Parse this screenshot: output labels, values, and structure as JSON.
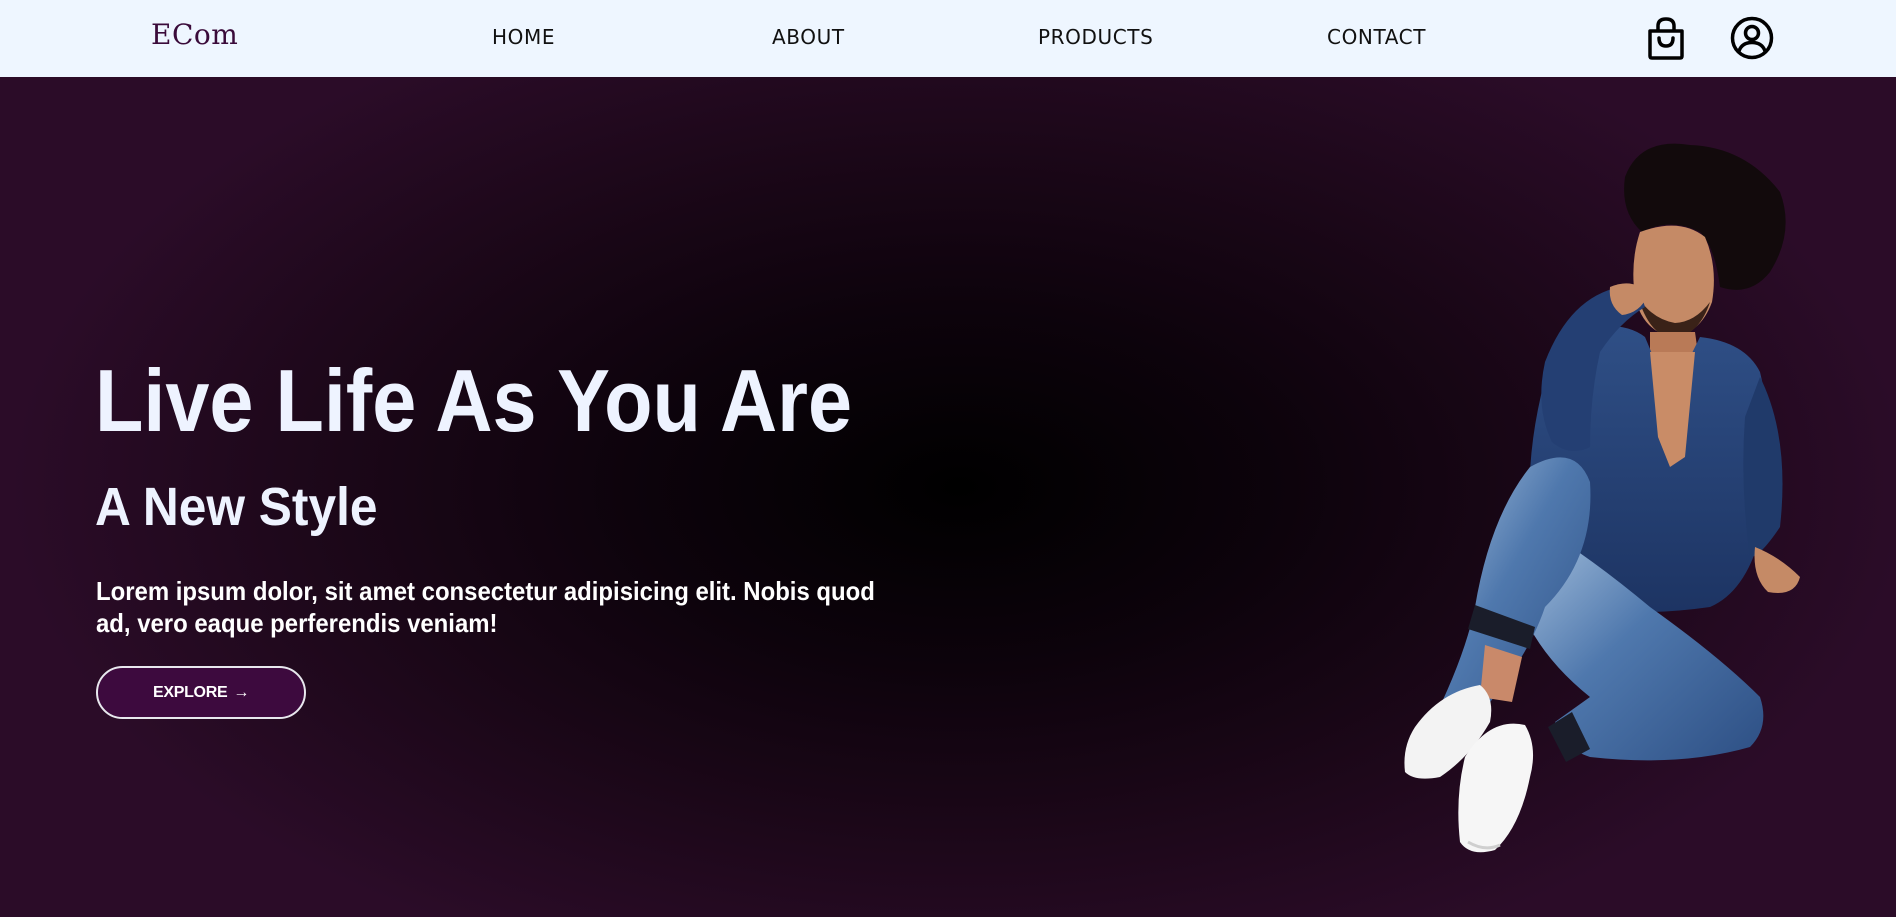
{
  "brand": {
    "logo_text": "ECom",
    "primary_color": "#3d0a3e",
    "nav_background": "#eef6ff"
  },
  "nav": {
    "links": [
      {
        "label": "HOME"
      },
      {
        "label": "ABOUT"
      },
      {
        "label": "PRODUCTS"
      },
      {
        "label": "CONTACT"
      }
    ],
    "icons": [
      "shopping-bag-icon",
      "user-profile-icon"
    ]
  },
  "hero": {
    "title": "Live Life As You Are",
    "subtitle": "A New Style",
    "description": "Lorem ipsum dolor, sit amet consectetur adipisicing elit. Nobis quod ad, vero eaque perferendis veniam!",
    "cta": {
      "label": "EXPLORE",
      "arrow": "→"
    },
    "background_colors": [
      "#000000",
      "#2b0c28"
    ]
  }
}
